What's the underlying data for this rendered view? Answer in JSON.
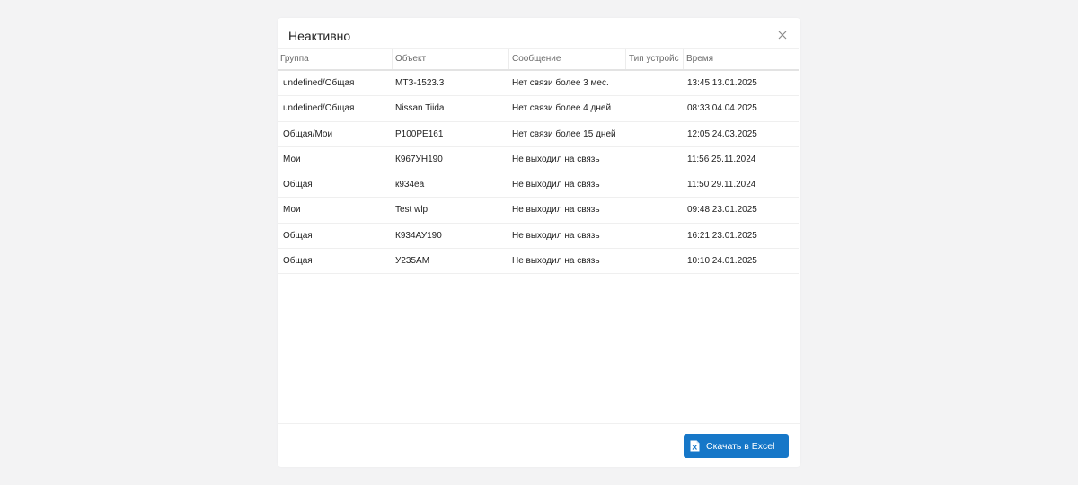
{
  "modal": {
    "title": "Неактивно",
    "close_icon": "close-icon"
  },
  "table": {
    "columns": [
      "Группа",
      "Объект",
      "Сообщение",
      "Тип устройс",
      "Время"
    ],
    "rows": [
      [
        "undefined/Общая",
        "МТЗ-1523.3",
        "Нет связи более 3 мес.",
        "",
        "13:45 13.01.2025"
      ],
      [
        "undefined/Общая",
        "Nissan Tiida",
        "Нет связи более 4 дней",
        "",
        "08:33 04.04.2025"
      ],
      [
        "Общая/Мои",
        "Р100РЕ161",
        "Нет связи более 15 дней",
        "",
        "12:05 24.03.2025"
      ],
      [
        "Мои",
        "К967УН190",
        "Не выходил на связь",
        "",
        "11:56 25.11.2024"
      ],
      [
        "Общая",
        "к934еа",
        "Не выходил на связь",
        "",
        "11:50 29.11.2024"
      ],
      [
        "Мои",
        "Test wlp",
        "Не выходил на связь",
        "",
        "09:48 23.01.2025"
      ],
      [
        "Общая",
        "К934АУ190",
        "Не выходил на связь",
        "",
        "16:21 23.01.2025"
      ],
      [
        "Общая",
        "У235АМ",
        "Не выходил на связь",
        "",
        "10:10 24.01.2025"
      ]
    ]
  },
  "footer": {
    "download_label": "Скачать в Excel",
    "download_icon": "excel-file-icon",
    "button_color": "#1677c8"
  }
}
